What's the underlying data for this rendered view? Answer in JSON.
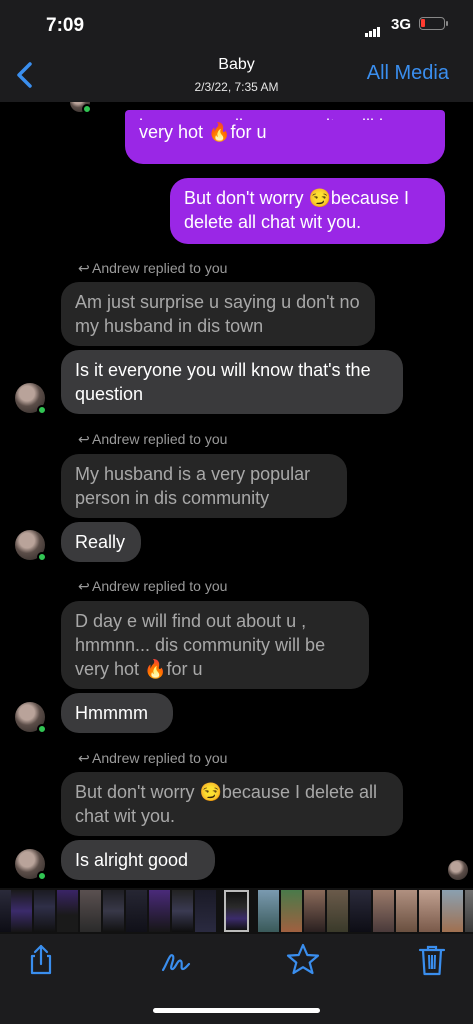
{
  "status_bar": {
    "time": "7:09",
    "network": "3G"
  },
  "nav": {
    "title": "Baby",
    "subtitle": "2/3/22, 7:35 AM",
    "all_media": "All Media",
    "back_icon": "chevron-left-icon"
  },
  "messages": {
    "sent_top_partial": "hmmmm... dis community will be",
    "sent_top_line": "very hot 🔥for u",
    "sent_2": "But don't worry 😏because I delete all chat wit you.",
    "reply_note": "Andrew replied to you",
    "q1": "Am just surprise u saying u don't no my husband in dis town",
    "r1": "Is it everyone you will know that's the question",
    "q2": "My husband is a very popular person in dis community",
    "r2": "Really",
    "q3": "D day e will find out about u , hmmnn... dis community will be very hot 🔥for u",
    "r3": "Hmmmm",
    "q4": "But don't worry 😏because I delete all chat wit you.",
    "r4": "Is alright good"
  },
  "toolbar": {
    "icons": [
      "share-icon",
      "markup-icon",
      "favorite-icon",
      "trash-icon"
    ]
  },
  "colors": {
    "sent_bubble": "#9a27e6",
    "received_bubble": "#3a3a3c",
    "accent": "#3a8eee",
    "online": "#31c553"
  }
}
